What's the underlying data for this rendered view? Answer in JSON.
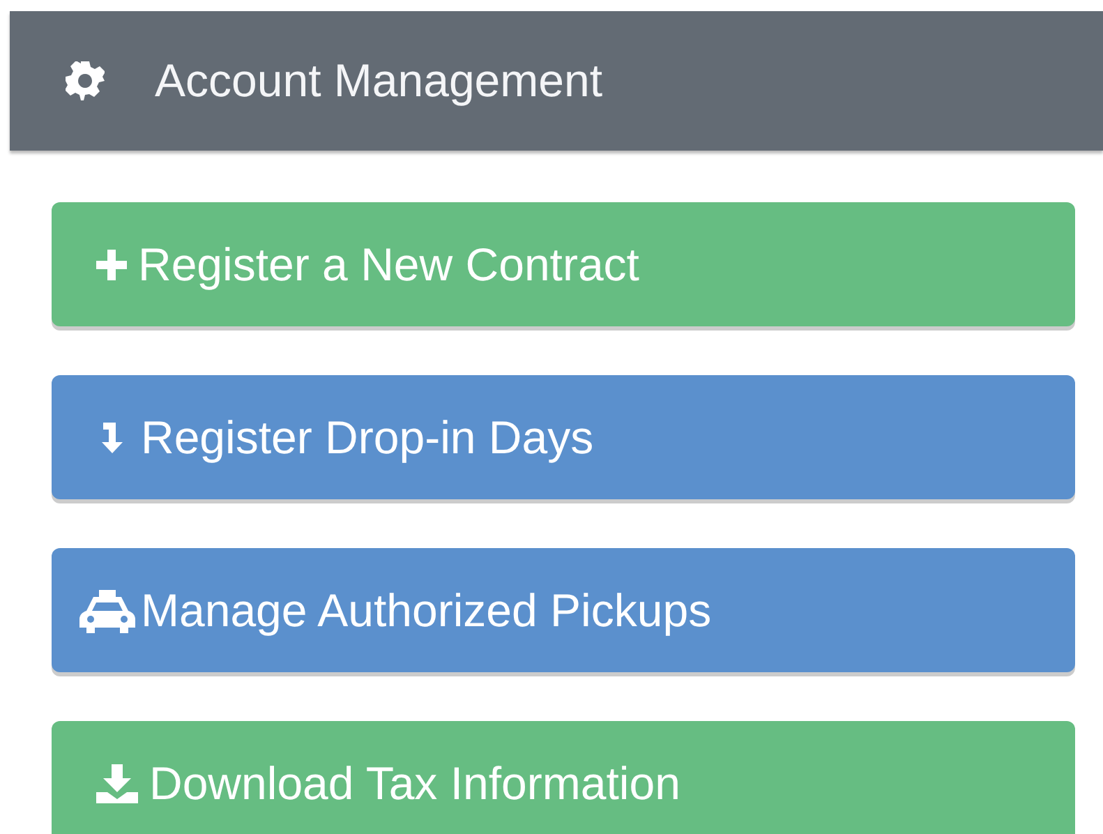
{
  "header": {
    "title": "Account Management"
  },
  "buttons": [
    {
      "label": "Register a New Contract",
      "kind": "success"
    },
    {
      "label": "Register Drop-in Days",
      "kind": "primary"
    },
    {
      "label": "Manage Authorized Pickups",
      "kind": "primary"
    },
    {
      "label": "Download Tax Information",
      "kind": "success"
    }
  ]
}
